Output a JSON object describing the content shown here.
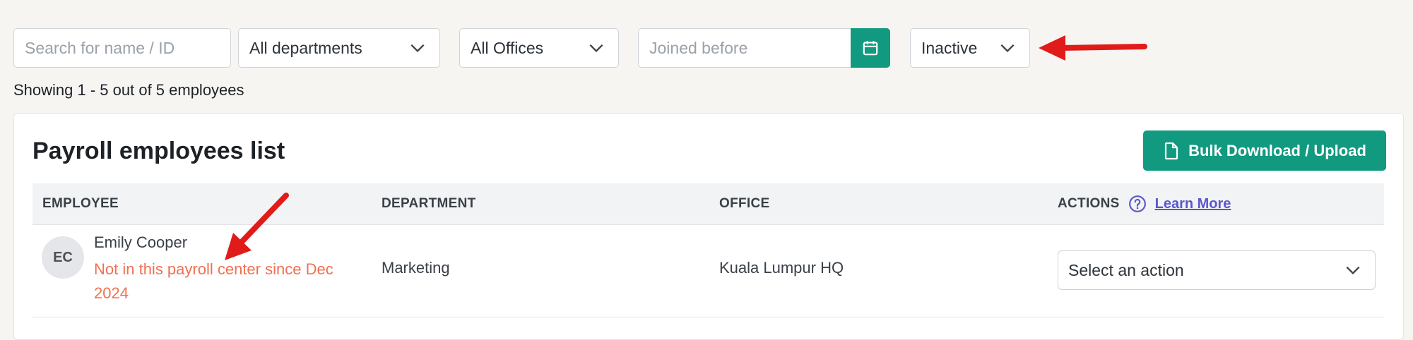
{
  "filters": {
    "search_placeholder": "Search for name / ID",
    "department": "All departments",
    "office": "All Offices",
    "joined_placeholder": "Joined before",
    "status": "Inactive"
  },
  "summary": "Showing 1 - 5 out of 5 employees",
  "card": {
    "title": "Payroll employees list",
    "bulk_button": "Bulk Download / Upload"
  },
  "table": {
    "headers": {
      "employee": "EMPLOYEE",
      "department": "DEPARTMENT",
      "office": "OFFICE",
      "actions": "ACTIONS",
      "learn_more": "Learn More"
    },
    "rows": [
      {
        "initials": "EC",
        "name": "Emily Cooper",
        "note": "Not in this payroll center since Dec 2024",
        "department": "Marketing",
        "office": "Kuala Lumpur HQ",
        "action_placeholder": "Select an action"
      }
    ]
  },
  "colors": {
    "accent": "#119a80",
    "annotation_arrow": "#e11a1a",
    "note_text": "#f07052",
    "link": "#5a57c9"
  }
}
